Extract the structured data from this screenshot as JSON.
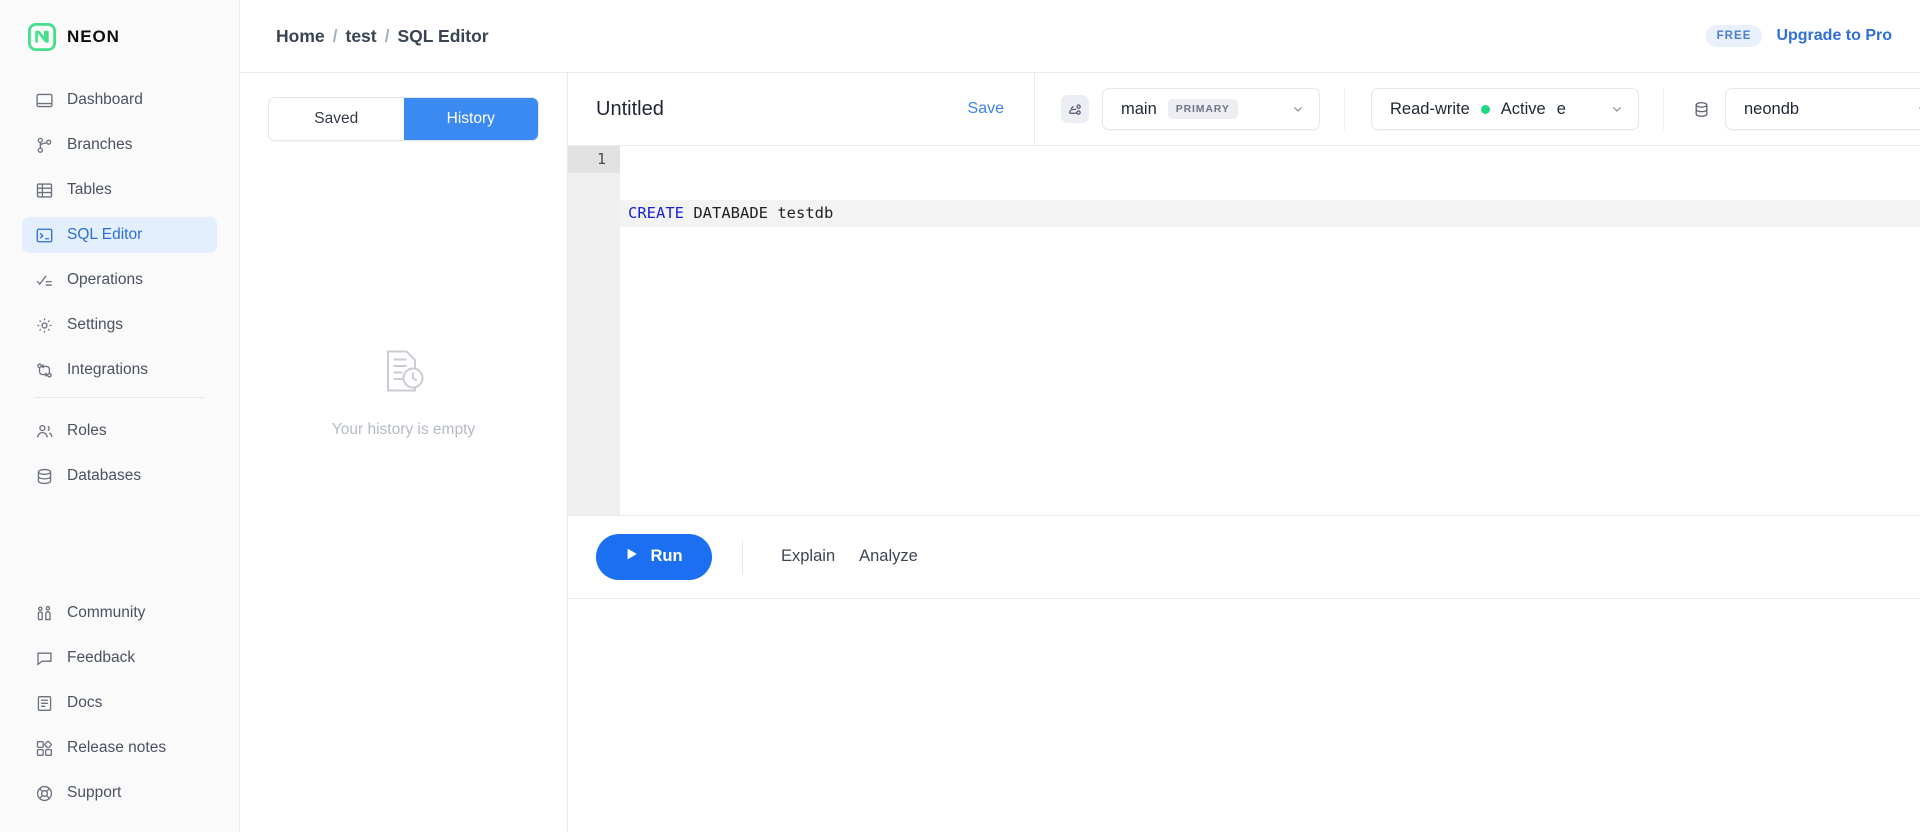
{
  "brand": {
    "name": "NEON",
    "logo_icon": "neon-logo-icon"
  },
  "sidebar": {
    "primary_items": [
      {
        "label": "Dashboard",
        "icon": "dashboard-icon",
        "active": false
      },
      {
        "label": "Branches",
        "icon": "branches-icon",
        "active": false
      },
      {
        "label": "Tables",
        "icon": "tables-icon",
        "active": false
      },
      {
        "label": "SQL Editor",
        "icon": "sql-editor-icon",
        "active": true
      },
      {
        "label": "Operations",
        "icon": "operations-icon",
        "active": false
      },
      {
        "label": "Settings",
        "icon": "gear-icon",
        "active": false
      },
      {
        "label": "Integrations",
        "icon": "integrations-icon",
        "active": false
      }
    ],
    "secondary_items": [
      {
        "label": "Roles",
        "icon": "roles-icon"
      },
      {
        "label": "Databases",
        "icon": "database-icon"
      }
    ],
    "footer_items": [
      {
        "label": "Community",
        "icon": "community-icon"
      },
      {
        "label": "Feedback",
        "icon": "feedback-icon"
      },
      {
        "label": "Docs",
        "icon": "docs-icon"
      },
      {
        "label": "Release notes",
        "icon": "release-notes-icon"
      },
      {
        "label": "Support",
        "icon": "support-icon"
      }
    ]
  },
  "topbar": {
    "breadcrumb": [
      "Home",
      "test",
      "SQL Editor"
    ],
    "separator": "/",
    "plan_badge": "FREE",
    "upgrade_label": "Upgrade to Pro"
  },
  "history_panel": {
    "tabs": [
      {
        "label": "Saved",
        "selected": false
      },
      {
        "label": "History",
        "selected": true
      }
    ],
    "empty_message": "Your history is empty",
    "empty_icon": "history-document-icon"
  },
  "editor": {
    "title": "Untitled",
    "save_label": "Save",
    "branch_select": {
      "icon": "branch-icon",
      "value": "main",
      "tag": "PRIMARY",
      "chevron": "chevron-down-icon"
    },
    "compute_select": {
      "mode": "Read-write",
      "status": "Active",
      "status_color": "#1dd882",
      "extra": "e",
      "chevron": "chevron-down-icon"
    },
    "database_select": {
      "icon": "database-icon",
      "value": "neondb",
      "chevron": "chevron-down-icon"
    },
    "code_lines": [
      {
        "number": "1",
        "current": true,
        "tokens": [
          {
            "t": "CREATE",
            "k": true
          },
          {
            "t": " DATABADE testdb",
            "k": false
          }
        ]
      }
    ]
  },
  "actions": {
    "run_label": "Run",
    "run_icon": "play-icon",
    "explain_label": "Explain",
    "analyze_label": "Analyze"
  },
  "colors": {
    "accent_blue": "#1d6ff2",
    "segment_blue": "#3b8af2",
    "active_nav_bg": "#e3effd",
    "active_green": "#1dd882",
    "logo_gradient_start": "#3ad6b0",
    "logo_gradient_end": "#40e07a"
  }
}
